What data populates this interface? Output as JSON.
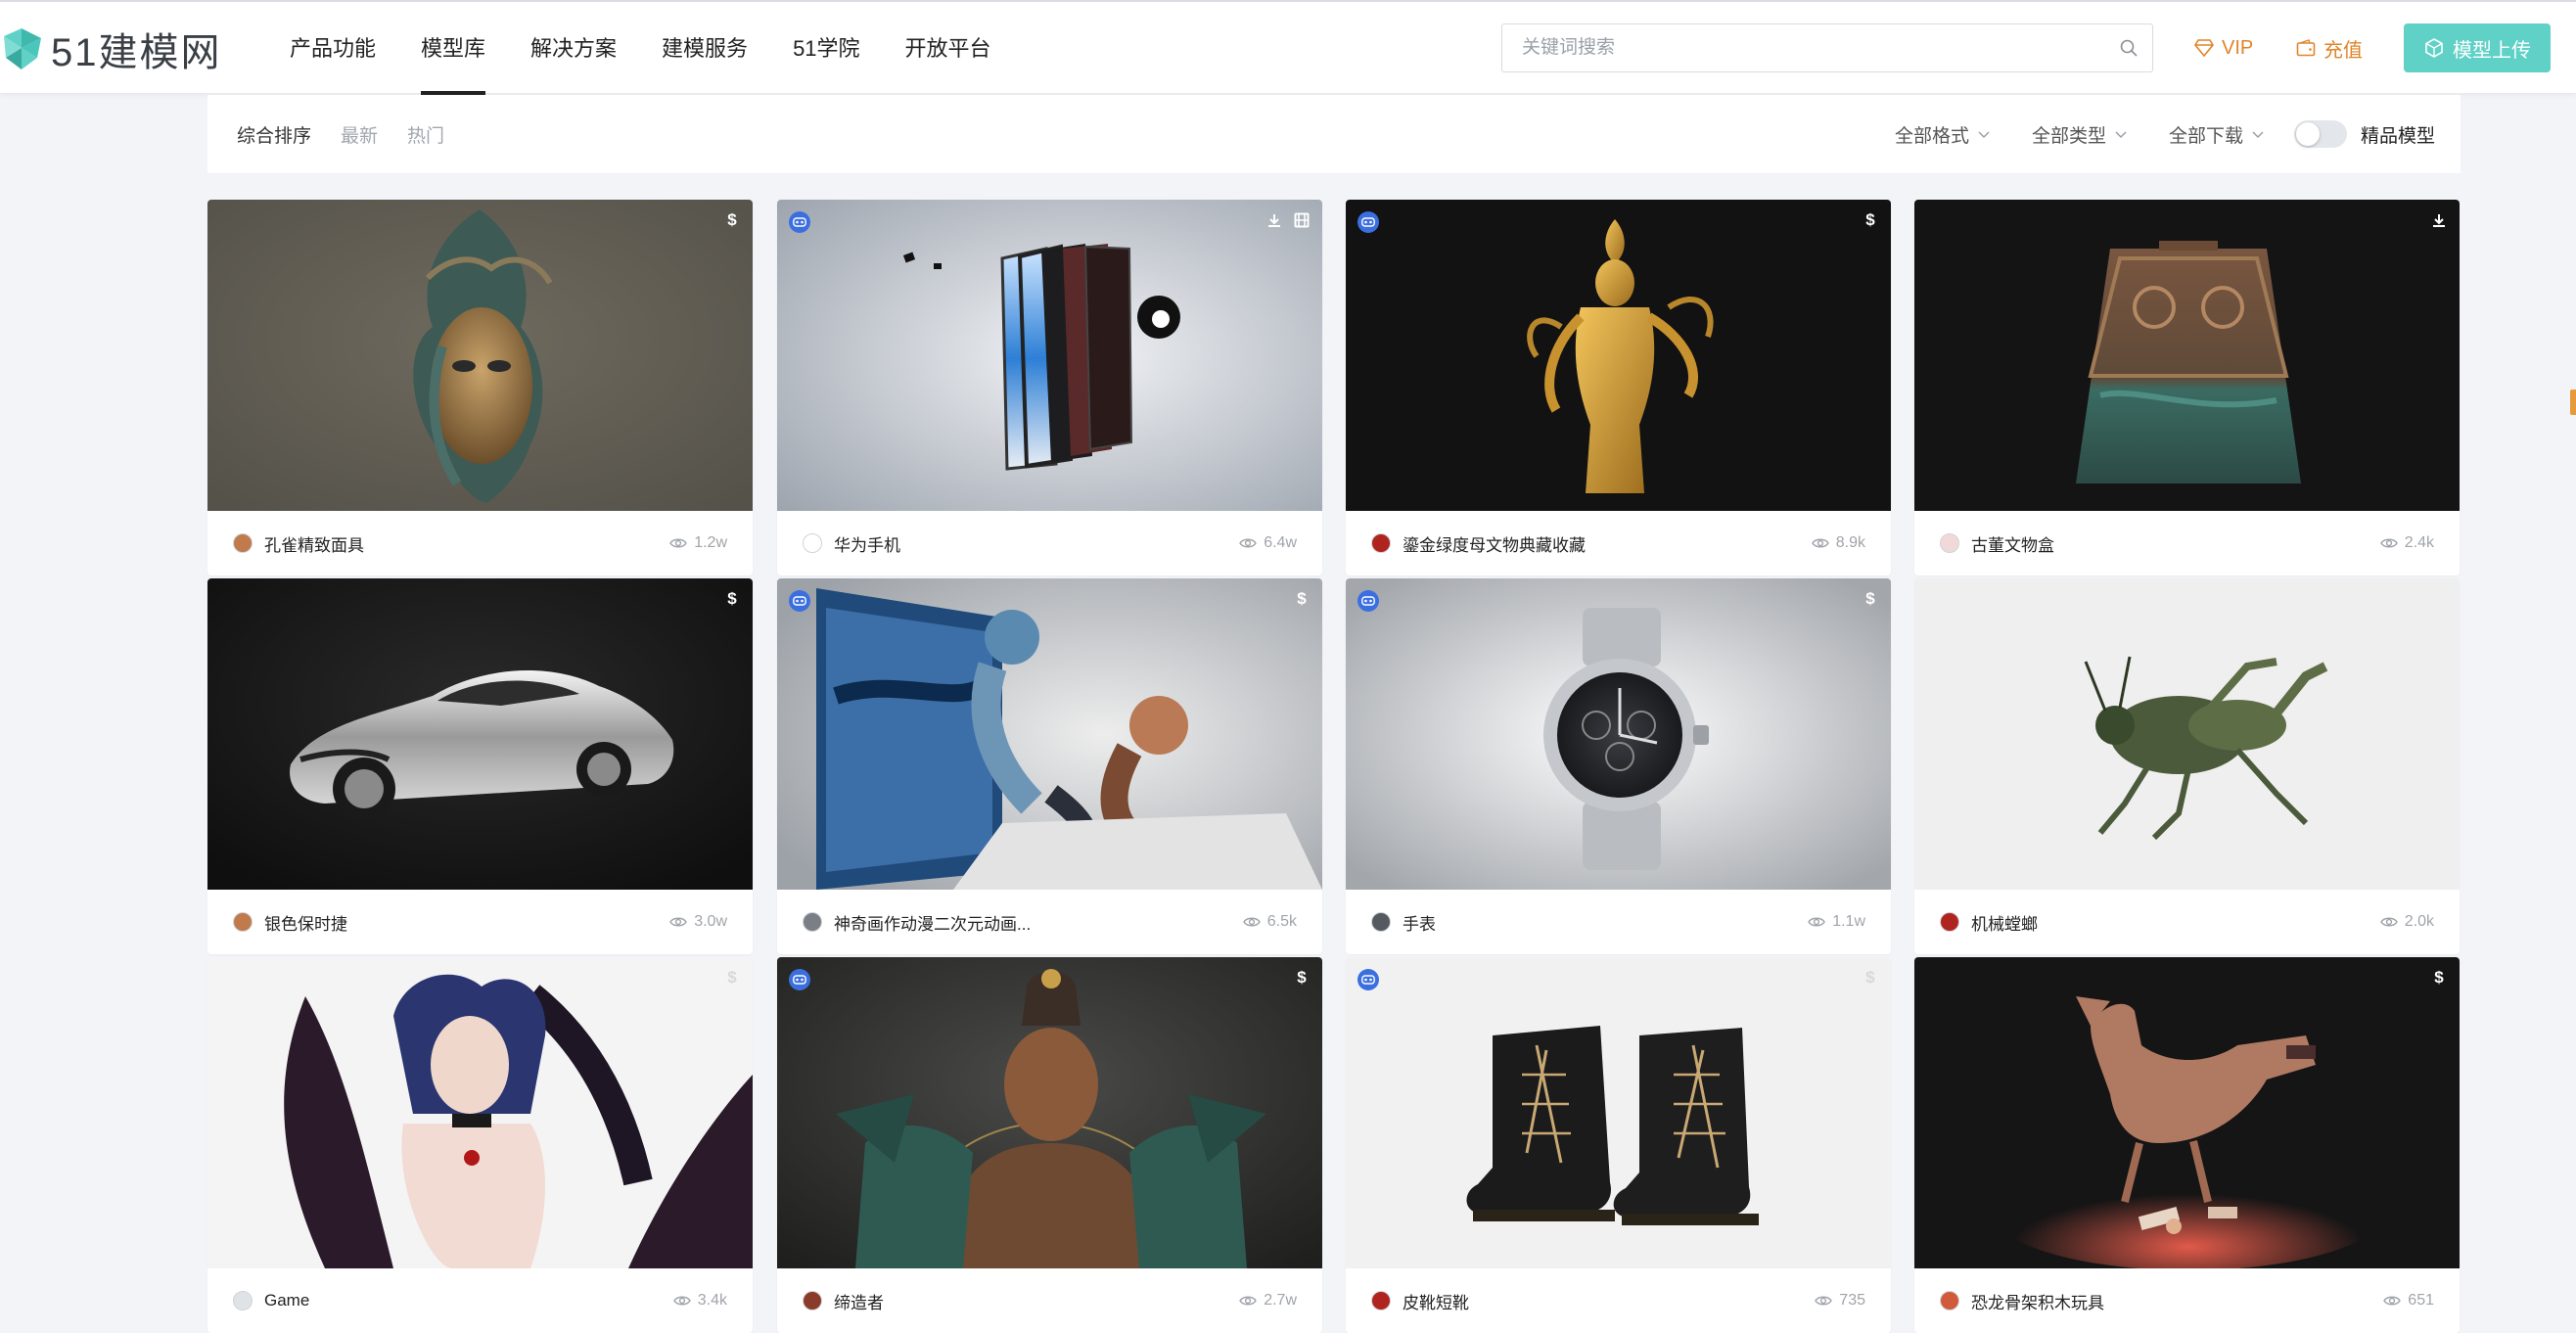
{
  "brand": {
    "logo_text": "51建模网",
    "accent": "#5fd1c7"
  },
  "nav": {
    "items": [
      {
        "label": "产品功能",
        "active": false
      },
      {
        "label": "模型库",
        "active": true
      },
      {
        "label": "解决方案",
        "active": false
      },
      {
        "label": "建模服务",
        "active": false
      },
      {
        "label": "51学院",
        "active": false
      },
      {
        "label": "开放平台",
        "active": false
      }
    ]
  },
  "search": {
    "placeholder": "关键词搜索",
    "value": ""
  },
  "header_actions": {
    "vip_label": "VIP",
    "recharge_label": "充值",
    "upload_label": "模型上传"
  },
  "sort": {
    "items": [
      "综合排序",
      "最新",
      "热门"
    ],
    "active": "综合排序"
  },
  "filters": {
    "format": "全部格式",
    "type": "全部类型",
    "download": "全部下载",
    "premium_label": "精品模型",
    "premium_on": false
  },
  "models": [
    {
      "title": "孔雀精致面具",
      "views": "1.2w",
      "vr_badge": false,
      "icons": [
        "paid"
      ],
      "theme": "mask",
      "avatar_color": "#c07a4c"
    },
    {
      "title": "华为手机",
      "views": "6.4w",
      "vr_badge": true,
      "icons": [
        "download",
        "film"
      ],
      "theme": "phone",
      "avatar_color": "#ffffff"
    },
    {
      "title": "鎏金绿度母文物典藏收藏",
      "views": "8.9k",
      "vr_badge": true,
      "icons": [
        "paid"
      ],
      "theme": "statue",
      "avatar_color": "#b0241f"
    },
    {
      "title": "古董文物盒",
      "views": "2.4k",
      "vr_badge": false,
      "icons": [
        "download"
      ],
      "theme": "box",
      "avatar_color": "#f2d9d9"
    },
    {
      "title": "银色保时捷",
      "views": "3.0w",
      "vr_badge": false,
      "icons": [
        "paid"
      ],
      "theme": "car",
      "avatar_color": "#c07a4c"
    },
    {
      "title": "神奇画作动漫二次元动画...",
      "views": "6.5k",
      "vr_badge": true,
      "icons": [
        "paid"
      ],
      "theme": "anime",
      "avatar_color": "#7a7f86"
    },
    {
      "title": "手表",
      "views": "1.1w",
      "vr_badge": true,
      "icons": [
        "paid"
      ],
      "theme": "watch",
      "avatar_color": "#555a60"
    },
    {
      "title": "机械螳螂",
      "views": "2.0k",
      "vr_badge": false,
      "icons": [],
      "theme": "mantis",
      "avatar_color": "#b0241f"
    },
    {
      "title": "Game",
      "views": "3.4k",
      "vr_badge": false,
      "icons": [
        "paid-faded"
      ],
      "theme": "demon",
      "avatar_color": "#dfe2e6"
    },
    {
      "title": "缔造者",
      "views": "2.7w",
      "vr_badge": true,
      "icons": [
        "paid"
      ],
      "theme": "warrior",
      "avatar_color": "#8a3b2a"
    },
    {
      "title": "皮靴短靴",
      "views": "735",
      "vr_badge": true,
      "icons": [
        "paid-faded"
      ],
      "theme": "boots",
      "avatar_color": "#b0241f"
    },
    {
      "title": "恐龙骨架积木玩具",
      "views": "651",
      "vr_badge": false,
      "icons": [
        "paid"
      ],
      "theme": "dino",
      "avatar_color": "#d05a3a"
    }
  ]
}
